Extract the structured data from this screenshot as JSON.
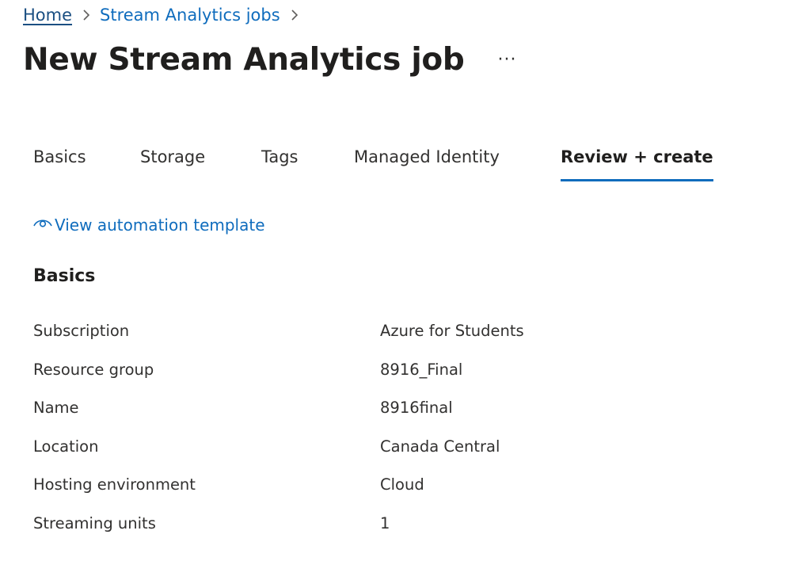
{
  "breadcrumb": {
    "home": "Home",
    "stream_analytics_jobs": "Stream Analytics jobs"
  },
  "page": {
    "title": "New Stream Analytics job",
    "more_label": "···"
  },
  "tabs": [
    {
      "label": "Basics",
      "active": false
    },
    {
      "label": "Storage",
      "active": false
    },
    {
      "label": "Tags",
      "active": false
    },
    {
      "label": "Managed Identity",
      "active": false
    },
    {
      "label": "Review + create",
      "active": true
    }
  ],
  "automation": {
    "label": "View automation template",
    "icon": "eye-icon"
  },
  "basics": {
    "heading": "Basics",
    "rows": [
      {
        "label": "Subscription",
        "value": "Azure for Students"
      },
      {
        "label": "Resource group",
        "value": "8916_Final"
      },
      {
        "label": "Name",
        "value": "8916final"
      },
      {
        "label": "Location",
        "value": "Canada Central"
      },
      {
        "label": "Hosting environment",
        "value": "Cloud"
      },
      {
        "label": "Streaming units",
        "value": "1"
      }
    ]
  },
  "colors": {
    "link": "#0f6cbd",
    "text": "#323130",
    "heading": "#201f1e",
    "tab_underline": "#0f6cbd"
  }
}
